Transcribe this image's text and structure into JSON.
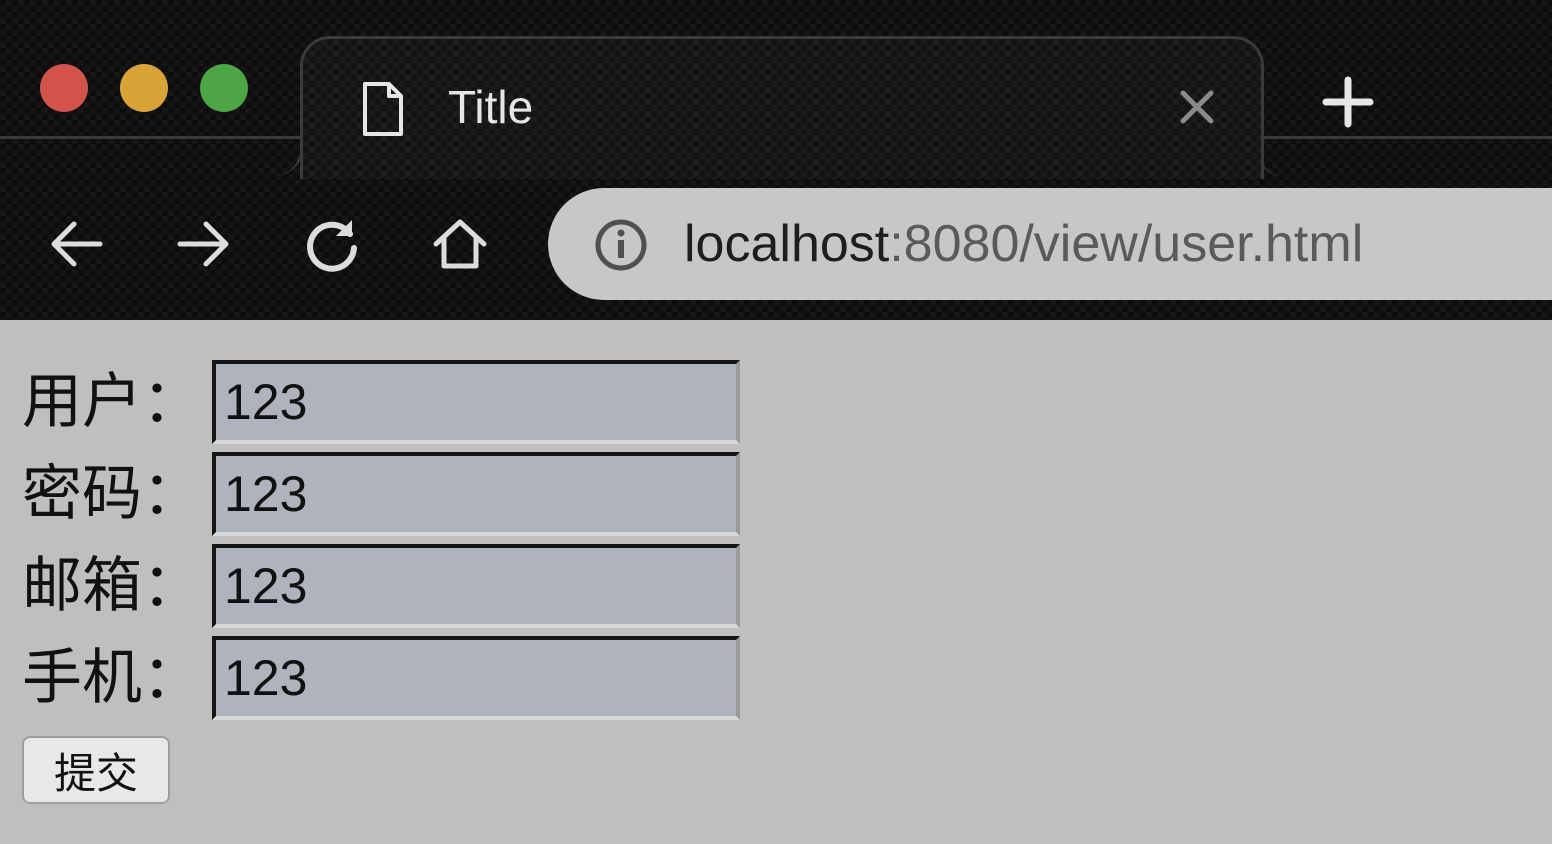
{
  "window": {
    "controls": [
      "close",
      "minimize",
      "zoom"
    ]
  },
  "tab": {
    "title": "Title",
    "icon": "document-icon",
    "close_icon": "close-icon"
  },
  "toolbar": {
    "new_tab_icon": "plus-icon",
    "nav": [
      "back-arrow-icon",
      "forward-arrow-icon",
      "reload-icon",
      "home-icon"
    ]
  },
  "address": {
    "host": "localhost",
    "rest": ":8080/view/user.html",
    "icon": "info-icon"
  },
  "form": {
    "fields": [
      {
        "label": "用户：",
        "value": "123"
      },
      {
        "label": "密码：",
        "value": "123"
      },
      {
        "label": "邮箱：",
        "value": "123"
      },
      {
        "label": "手机：",
        "value": "123"
      }
    ],
    "submit_label": "提交"
  },
  "colors": {
    "chrome_bg": "#0d0d0d",
    "page_bg": "#bfbfbf",
    "input_bg": "#aeb3bd",
    "close_light": "#d2534b",
    "minimize_light": "#d8a437",
    "zoom_light": "#4ea545"
  }
}
